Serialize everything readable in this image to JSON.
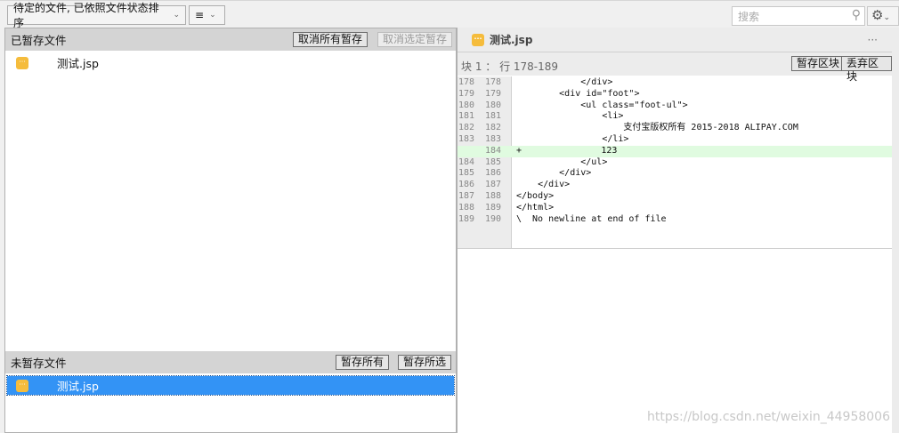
{
  "toolbar": {
    "sort_select": "待定的文件, 已依照文件状态排序",
    "view_icon": "≡",
    "search_placeholder": "搜索"
  },
  "staged": {
    "title": "已暂存文件",
    "unstage_all": "取消所有暂存",
    "unstage_selected": "取消选定暂存",
    "files": [
      {
        "name": "测试.jsp"
      }
    ]
  },
  "unstaged": {
    "title": "未暂存文件",
    "stage_all": "暂存所有",
    "stage_selected": "暂存所选",
    "files": [
      {
        "name": "测试.jsp"
      }
    ]
  },
  "diff": {
    "file": "测试.jsp",
    "more": "···",
    "hunk_label": "块 1 ： 行 178-189",
    "stage_hunk": "暂存区块",
    "discard_hunk": "丢弃区块",
    "lines": [
      {
        "old": "178",
        "new": "178",
        "mark": "",
        "text": "            </div>"
      },
      {
        "old": "179",
        "new": "179",
        "mark": "",
        "text": "        <div id=\"foot\">"
      },
      {
        "old": "180",
        "new": "180",
        "mark": "",
        "text": "            <ul class=\"foot-ul\">"
      },
      {
        "old": "181",
        "new": "181",
        "mark": "",
        "text": "                <li>"
      },
      {
        "old": "182",
        "new": "182",
        "mark": "",
        "text": "                    支付宝版权所有 2015-2018 ALIPAY.COM"
      },
      {
        "old": "183",
        "new": "183",
        "mark": "",
        "text": "                </li>"
      },
      {
        "old": "",
        "new": "184",
        "mark": "+",
        "text": "                123"
      },
      {
        "old": "184",
        "new": "185",
        "mark": "",
        "text": "            </ul>"
      },
      {
        "old": "185",
        "new": "186",
        "mark": "",
        "text": "        </div>"
      },
      {
        "old": "186",
        "new": "187",
        "mark": "",
        "text": "    </div>"
      },
      {
        "old": "187",
        "new": "188",
        "mark": "",
        "text": "</body>"
      },
      {
        "old": "188",
        "new": "189",
        "mark": "",
        "text": "</html>"
      },
      {
        "old": "189",
        "new": "190",
        "mark": "\\",
        "text": "No newline at end of file"
      }
    ]
  },
  "watermark": "https://blog.csdn.net/weixin_44958006"
}
